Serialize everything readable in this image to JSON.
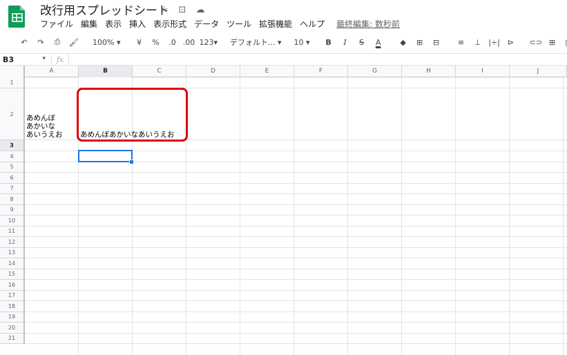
{
  "doc": {
    "title": "改行用スプレッドシート",
    "star_icon": "☆",
    "folder_icon": "⊡",
    "cloud_icon": "☁"
  },
  "menu": [
    "ファイル",
    "編集",
    "表示",
    "挿入",
    "表示形式",
    "データ",
    "ツール",
    "拡張機能",
    "ヘルプ"
  ],
  "last_edit": "最終編集: 数秒前",
  "toolbar": {
    "undo": "↶",
    "redo": "↷",
    "print": "⎙",
    "paint_format": "🖌",
    "zoom": "100%",
    "currency": "¥",
    "percent": "%",
    "decimal_decrease": ".0",
    "decimal_increase": ".00",
    "more_formats": "123",
    "font": "デフォルト...",
    "font_size": "10",
    "bold": "B",
    "italic": "I",
    "strikethrough": "S",
    "text_color": "A",
    "fill_color": "◆",
    "borders": "⊞",
    "merge": "⊟",
    "h_align": "≡",
    "v_align": "⊥",
    "wrap": "|÷|",
    "rotate": "⊳",
    "link": "⊂⊃",
    "comment": "⊞",
    "chart": "▥",
    "dropdown": "▾"
  },
  "formula_bar": {
    "cell_ref": "B3",
    "fx": "fx",
    "value": ""
  },
  "columns": [
    "A",
    "B",
    "C",
    "D",
    "E",
    "F",
    "G",
    "H",
    "I",
    "J"
  ],
  "rows": [
    "1",
    "2",
    "3",
    "4",
    "5",
    "6",
    "7",
    "8",
    "9",
    "10",
    "11",
    "12",
    "13",
    "14",
    "15",
    "16",
    "17",
    "18",
    "19",
    "20",
    "21"
  ],
  "selected": {
    "column": "B",
    "row": "3"
  },
  "cells": {
    "A2": "あめんぼ\nあかいな\nあいうえお",
    "B2": "あめんぼあかいなあいうえお"
  },
  "colors": {
    "sheets_green": "#0f9d58",
    "selection_blue": "#1a73e8",
    "annotation_red": "#e00000"
  }
}
